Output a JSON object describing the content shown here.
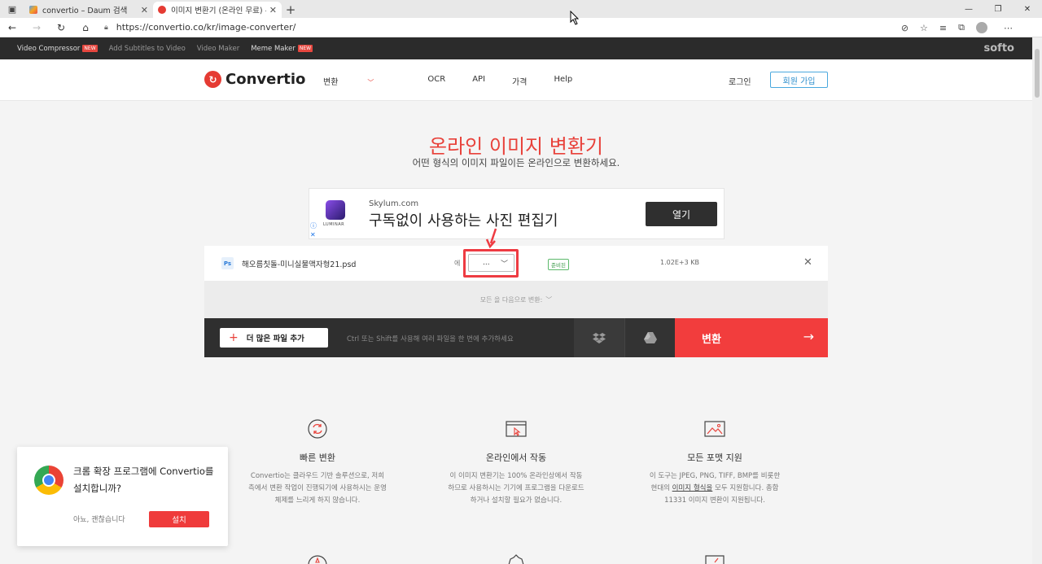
{
  "browser": {
    "tabs": [
      {
        "title": "convertio – Daum 검색",
        "active": false
      },
      {
        "title": "이미지 변환기 (온라인 무료) — C",
        "active": true
      }
    ],
    "url": "https://convertio.co/kr/image-converter/"
  },
  "topbar": {
    "items": [
      {
        "label": "Video Compressor",
        "badge": "NEW"
      },
      {
        "label": "Add Subtitles to Video",
        "badge": ""
      },
      {
        "label": "Video Maker",
        "badge": ""
      },
      {
        "label": "Meme Maker",
        "badge": "NEW"
      }
    ],
    "brand": "softo"
  },
  "header": {
    "logo": "Convertio",
    "nav": [
      "변환",
      "OCR",
      "API",
      "가격",
      "Help"
    ],
    "login": "로그인",
    "signup": "회원 가입"
  },
  "hero": {
    "title": "온라인 이미지 변환기",
    "subtitle": "어떤 형식의 이미지 파일이든 온라인으로 변환하세요."
  },
  "ad": {
    "logo_text": "LUMINAR",
    "domain": "Skylum.com",
    "headline": "구독없이 사용하는 사진 편집기",
    "button": "열기"
  },
  "converter": {
    "file_name": "해오름칫돌-미니실물액자형21.psd",
    "to_label": "에",
    "format_value": "...",
    "status": "준비된",
    "file_size": "1.02E+3 KB",
    "convert_all_label": "모든 을 다음으로 변환:",
    "add_files": "더 많은 파일 추가",
    "hint": "Ctrl 또는 Shift를 사용해 여러 파일을 한 번에 추가하세요",
    "convert_button": "변환"
  },
  "features": [
    {
      "title": "빠른 변환",
      "desc": "Convertio는 클라우드 기반 솔루션으로, 저희 측에서 변환 작업이 진행되기에 사용하시는 운영 체제를 느리게 하지 않습니다."
    },
    {
      "title": "온라인에서 작동",
      "desc": "이 이미지 변환기는 100% 온라인상에서 작동하므로 사용하시는 기기에 프로그램을 다운로드하거나 설치할 필요가 없습니다."
    },
    {
      "title": "모든 포맷 지원",
      "desc_pre": "이 도구는 JPEG, PNG, TIFF, BMP를 비롯한 현대의 ",
      "desc_link": "이미지 형식을",
      "desc_post": " 모두 지원합니다. 총합 11331 이미지 변환이 지원됩니다."
    }
  ],
  "popup": {
    "message": "크롬 확장 프로그램에 Convertio를 설치합니까?",
    "decline": "아뇨, 괜찮습니다",
    "install": "설치"
  },
  "colors": {
    "accent": "#f23d3d",
    "dark": "#2f2f2f",
    "link": "#2d8fcd"
  }
}
